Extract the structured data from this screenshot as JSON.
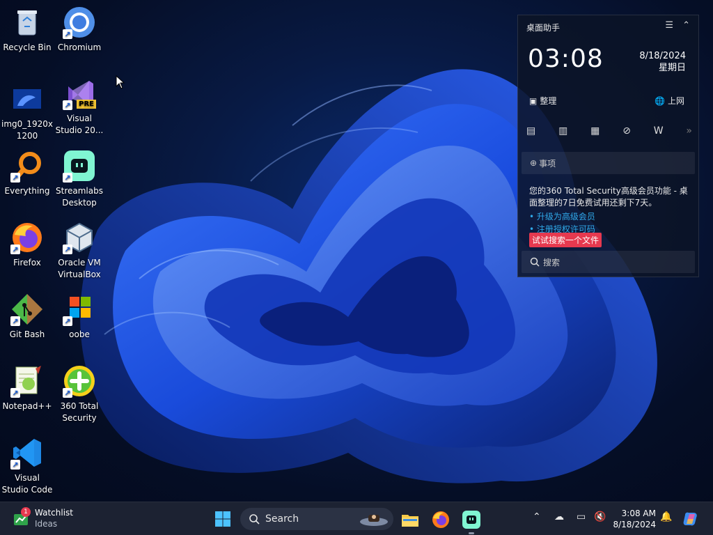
{
  "desktop_icons": [
    {
      "label": "Recycle Bin"
    },
    {
      "label": "Chromium"
    },
    {
      "label": "img0_1920x\n1200"
    },
    {
      "label": "Visual\nStudio 20..."
    },
    {
      "label": "Everything"
    },
    {
      "label": "Streamlabs\nDesktop"
    },
    {
      "label": "Firefox"
    },
    {
      "label": "Oracle VM\nVirtualBox"
    },
    {
      "label": "Git Bash"
    },
    {
      "label": "oobe"
    },
    {
      "label": "Notepad++"
    },
    {
      "label": "360 Total\nSecurity"
    },
    {
      "label": "Visual\nStudio Code"
    }
  ],
  "vs_badge": "PRE",
  "widget": {
    "title": "桌面助手",
    "time": "03:08",
    "date": "8/18/2024",
    "weekday": "星期日",
    "organize": "整理",
    "internet": "上网",
    "todo": "事项",
    "notice": "您的360 Total Security高级会员功能 - 桌面整理的7日免费试用还剩下7天。",
    "link_upgrade": "• 升级为高级会员",
    "link_register": "• 注册授权许可码",
    "tooltip": "试试搜索一个文件",
    "search_placeholder": "搜索"
  },
  "taskbar": {
    "watchlist_title": "Watchlist",
    "watchlist_sub": "Ideas",
    "watchlist_badge": "1",
    "search_label": "Search",
    "time": "3:08 AM",
    "date": "8/18/2024"
  },
  "colors": {
    "taskbar": "#1c2232",
    "accent": "#2fa8e8",
    "tooltip": "#e6394f"
  }
}
